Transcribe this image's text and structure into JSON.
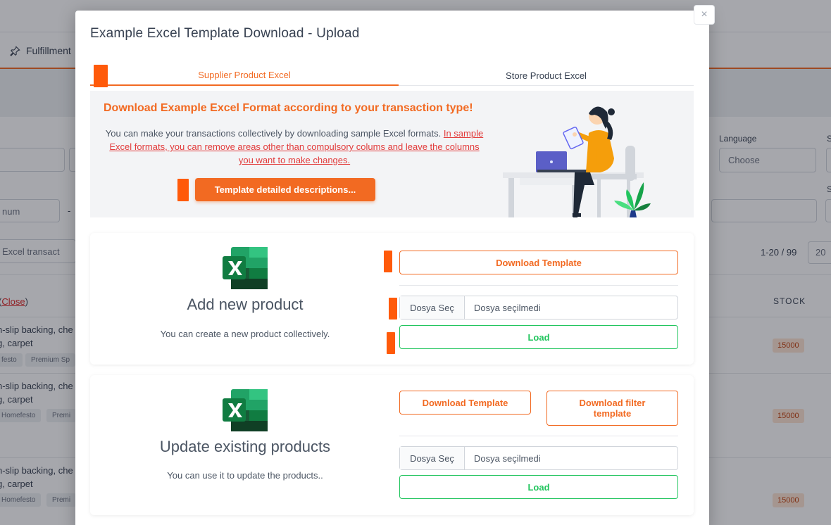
{
  "background": {
    "nav_item": "Fulfillment",
    "language_label": "Language",
    "language_value": "Choose",
    "s_label_1": "S",
    "s_label_2": "S",
    "min_placeholder": "num",
    "dash": "-",
    "excel_button": "Excel transact",
    "pagination": "1-20 / 99",
    "page_size": "20",
    "close_prefix": "(",
    "close_link": "Close",
    "close_suffix": ")",
    "stock_header": "STOCK",
    "rows": [
      {
        "line1": "n-slip backing, che",
        "line2": "g, carpet",
        "chip1": "festo",
        "chip2": "Premium Sp",
        "stock": "15000"
      },
      {
        "line1": "n-slip backing, che",
        "line2": "g, carpet",
        "chip1": "Homefesto",
        "chip2": "Premi",
        "stock": "15000"
      },
      {
        "line1": "n-slip backing, che",
        "line2": "g, carpet",
        "chip1": "Homefesto",
        "chip2": "Premi",
        "stock": "15000"
      }
    ]
  },
  "modal": {
    "title": "Example Excel Template Download - Upload",
    "close_symbol": "×",
    "tabs": [
      {
        "label": "Supplier Product Excel",
        "active": true
      },
      {
        "label": "Store Product Excel",
        "active": false
      }
    ],
    "info": {
      "heading": "Download Example Excel Format according to your transaction type!",
      "text_plain": "You can make your transactions collectively by downloading sample Excel formats.",
      "text_link": "In sample Excel formats, you can remove areas other than compulsory colums and leave the columns you want to make changes.",
      "button": "Template detailed descriptions..."
    },
    "cards": [
      {
        "title": "Add new product",
        "description": "You can create a new product collectively.",
        "download_button": "Download Template",
        "file_button": "Dosya Seç",
        "file_status": "Dosya seçilmedi",
        "load_button": "Load"
      },
      {
        "title": "Update existing products",
        "description": "You can use it to update the products..",
        "download_button": "Download Template",
        "download_filter_button": "Download filter template",
        "file_button": "Dosya Seç",
        "file_status": "Dosya seçilmedi",
        "load_button": "Load"
      }
    ],
    "icons": {
      "excel": "excel-icon",
      "close": "close-icon",
      "pin": "pin-icon"
    }
  },
  "colors": {
    "accent": "#f26a22",
    "success": "#22c55e",
    "link": "#e23b3b",
    "marker": "#ff5a0a"
  }
}
